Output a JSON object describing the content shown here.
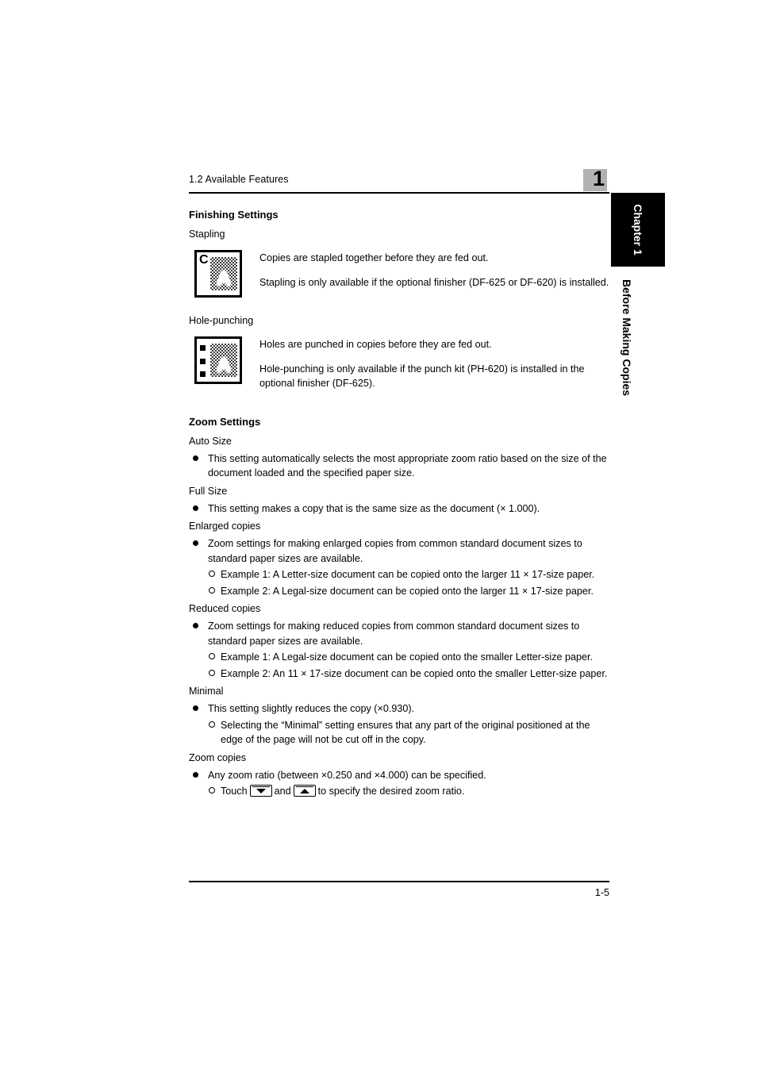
{
  "header": {
    "section_title": "1.2 Available Features",
    "chapter_number": "1"
  },
  "side_tab": {
    "chapter_label": "Chapter 1",
    "chapter_subtitle": "Before Making Copies"
  },
  "footer": {
    "page_number": "1-5"
  },
  "sections": [
    {
      "heading": "Finishing Settings",
      "items": [
        {
          "subhead": "Stapling",
          "icon": "stapled-page-icon",
          "icon_glyph": "A",
          "icon_mark": "C",
          "paragraphs": [
            "Copies are stapled together before they are fed out.",
            "Stapling is only available if the optional finisher (DF-625 or DF-620) is installed."
          ]
        },
        {
          "subhead": "Hole-punching",
          "icon": "hole-punched-page-icon",
          "icon_glyph": "A",
          "paragraphs": [
            "Holes are punched in copies before they are fed out.",
            "Hole-punching is only available if the punch kit (PH-620) is installed in the optional finisher (DF-625)."
          ]
        }
      ]
    },
    {
      "heading": "Zoom Settings",
      "groups": [
        {
          "subhead": "Auto Size",
          "bullets": [
            "This setting automatically selects the most appropriate zoom ratio based on the size of the document loaded and the specified paper size."
          ],
          "sub_bullets": []
        },
        {
          "subhead": "Full Size",
          "bullets": [
            "This setting makes a copy that is the same size as the document (× 1.000)."
          ],
          "sub_bullets": []
        },
        {
          "subhead": "Enlarged copies",
          "bullets": [
            "Zoom settings for making enlarged copies from common standard document sizes to standard paper sizes are available."
          ],
          "sub_bullets": [
            "Example 1: A Letter-size document can be copied onto the larger 11 × 17-size paper.",
            "Example 2: A Legal-size document can be copied onto the larger 11 × 17-size paper."
          ]
        },
        {
          "subhead": "Reduced copies",
          "bullets": [
            "Zoom settings for making reduced copies from common standard document sizes to standard paper sizes are available."
          ],
          "sub_bullets": [
            "Example 1: A Legal-size document can be copied onto the smaller Letter-size paper.",
            "Example 2: An 11 × 17-size document can be copied onto the smaller Letter-size paper."
          ]
        },
        {
          "subhead": "Minimal",
          "bullets": [
            "This setting slightly reduces the copy (×0.930)."
          ],
          "sub_bullets": [
            "Selecting the “Minimal” setting ensures that any part of the original positioned at the edge of the page will not be cut off in the copy."
          ]
        },
        {
          "subhead": "Zoom copies",
          "bullets": [
            "Any zoom ratio (between ×0.250 and ×4.000) can be specified."
          ],
          "sub_bullets": []
        }
      ],
      "touch_instruction": {
        "before": "Touch",
        "middle": "and",
        "after": "to specify the desired zoom ratio.",
        "key_down": "zoom-down-key",
        "key_up": "zoom-up-key"
      }
    }
  ]
}
